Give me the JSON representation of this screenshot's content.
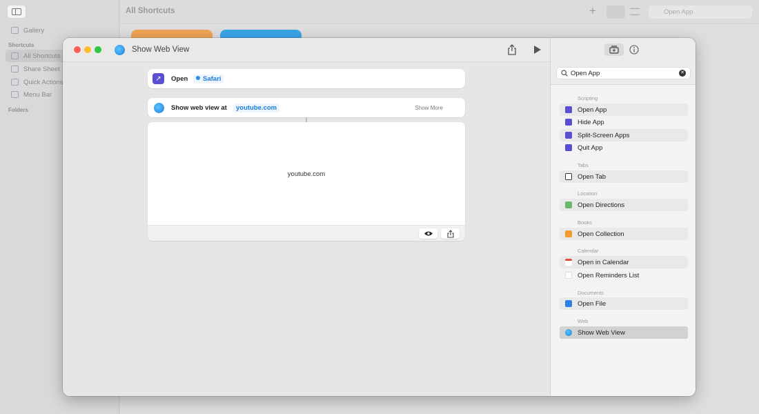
{
  "background": {
    "title": "All Shortcuts",
    "search_value": "Open App",
    "sidebar": {
      "gallery": "Gallery",
      "section_shortcuts": "Shortcuts",
      "items": [
        "All Shortcuts",
        "Share Sheet",
        "Quick Actions",
        "Menu Bar"
      ],
      "section_folders": "Folders"
    }
  },
  "window": {
    "title": "Show Web View",
    "actions": {
      "open": {
        "label": "Open",
        "app": "Safari"
      },
      "web": {
        "label": "Show web view at",
        "url": "youtube.com",
        "show_more": "Show More"
      }
    },
    "preview": {
      "url": "youtube.com"
    }
  },
  "panel": {
    "search_value": "Open App",
    "groups": [
      {
        "title": "Scripting",
        "items": [
          "Open App",
          "Hide App",
          "Split-Screen Apps",
          "Quit App"
        ]
      },
      {
        "title": "Tabs",
        "items": [
          "Open Tab"
        ]
      },
      {
        "title": "Location",
        "items": [
          "Open Directions"
        ]
      },
      {
        "title": "Books",
        "items": [
          "Open Collection"
        ]
      },
      {
        "title": "Calendar",
        "items": [
          "Open in Calendar",
          "Open Reminders List"
        ]
      },
      {
        "title": "Documents",
        "items": [
          "Open File"
        ]
      },
      {
        "title": "Web",
        "items": [
          "Show Web View"
        ]
      }
    ]
  },
  "colors": {
    "accent": "#1a7de0",
    "action_purple": "#5a4fd0",
    "close": "#ff5f57",
    "minimize": "#febc2e",
    "zoom": "#28c840"
  }
}
